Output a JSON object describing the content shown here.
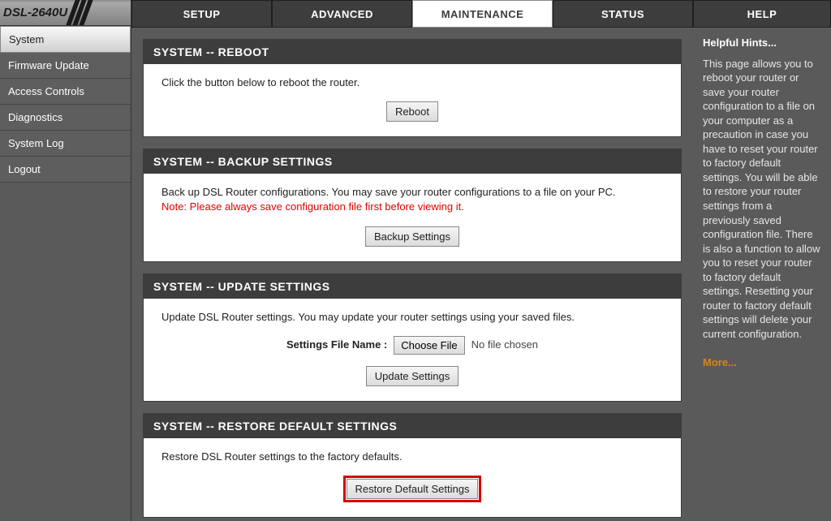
{
  "model": "DSL-2640U",
  "tabs": {
    "setup": "SETUP",
    "advanced": "ADVANCED",
    "maintenance": "MAINTENANCE",
    "status": "STATUS",
    "help": "HELP"
  },
  "sidebar": {
    "system": "System",
    "firmware": "Firmware Update",
    "access": "Access Controls",
    "diagnostics": "Diagnostics",
    "syslog": "System Log",
    "logout": "Logout"
  },
  "reboot": {
    "header": "SYSTEM -- REBOOT",
    "text": "Click the button below to reboot the router.",
    "button": "Reboot"
  },
  "backup": {
    "header": "SYSTEM -- BACKUP SETTINGS",
    "text": "Back up DSL Router configurations. You may save your router configurations to a file on your PC.",
    "note": "Note: Please always save configuration file first before viewing it.",
    "button": "Backup Settings"
  },
  "update": {
    "header": "SYSTEM -- UPDATE SETTINGS",
    "text": "Update DSL Router settings. You may update your router settings using your saved files.",
    "file_label": "Settings File Name :",
    "choose_file": "Choose File",
    "file_status": "No file chosen",
    "button": "Update Settings"
  },
  "restore": {
    "header": "SYSTEM -- RESTORE DEFAULT SETTINGS",
    "text": "Restore DSL Router settings to the factory defaults.",
    "button": "Restore Default Settings"
  },
  "help": {
    "title": "Helpful Hints...",
    "body": "This page allows you to reboot your router or save your router configuration to a file on your computer as a precaution in case you have to reset your router to factory default settings. You will be able to restore your router settings from a previously saved configuration file. There is also a function to allow you to reset your router to factory default settings. Resetting your router to factory default settings will delete your current configuration.",
    "more": "More..."
  }
}
